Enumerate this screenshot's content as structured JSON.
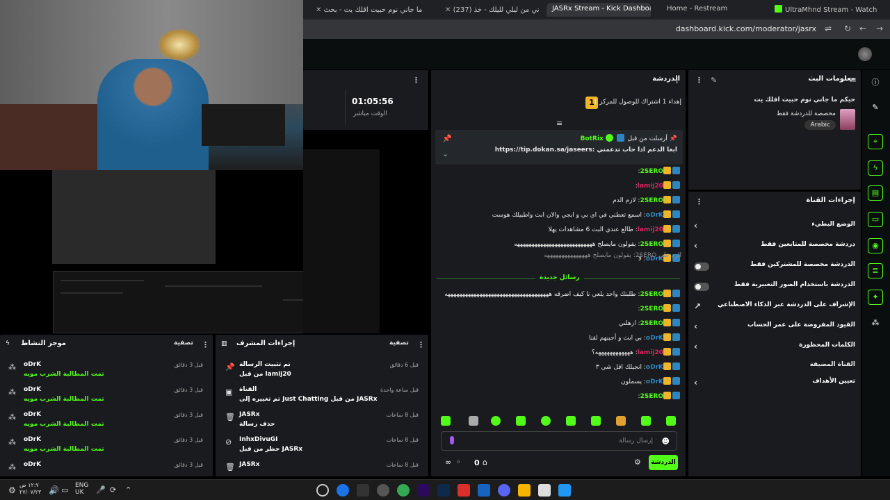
{
  "browser": {
    "tabs": [
      {
        "label": "ما جاني نوم حبيت اقلك يت - بحث",
        "active": false
      },
      {
        "label": "(237) خذني من ليلي لليلك - خذ...",
        "active": false
      },
      {
        "label": "JASRx Stream - Kick Dashboard",
        "active": true
      },
      {
        "label": "Home - Restream",
        "active": false
      },
      {
        "label": "UltraMhnd Stream - Watch",
        "active": false
      }
    ],
    "url": "dashboard.kick.com/moderator/jasrx"
  },
  "stream_panel": {
    "timer": "01:05:56",
    "timer_label": "الوقت مباشر"
  },
  "chat": {
    "title": "الدردشة",
    "goal_badge": "1",
    "goal_text": "إهداء 1 اشتراك للوصول للمركز 1",
    "pinned": {
      "label": "أرسلت من قبل",
      "user": "BotRix",
      "text": "ابغا الدعم اذا حاب تدعمني :https://tip.dokan.sa/jaseers"
    },
    "messages": [
      {
        "user": "2SERO",
        "text": "",
        "color": "#53fc18"
      },
      {
        "user": "lamij20",
        "text": "",
        "color": "#e0245e"
      },
      {
        "user": "2SERO",
        "text": "لازم الدم",
        "color": "#53fc18"
      },
      {
        "user": "oDrK",
        "text": "اسمع تعطني في اي بي و ايجي والان ابث واطبيلك هوست",
        "color": "#2e86c1"
      },
      {
        "user": "lamij20",
        "text": "طالع عندي البث 6 مشاهدات يهلا",
        "color": "#e0245e"
      },
      {
        "user": "2SERO",
        "text": "يقولون مايصلح هههههههههههههههههههههههههههه",
        "color": "#53fc18"
      },
      {
        "user": "oDrK",
        "text": "لا",
        "color": "#2e86c1"
      }
    ],
    "reply_to": "الرد على 2SERO: يقولون مايصلح هههههههههههههههه",
    "new_messages": "رسائل جديدة",
    "messages_after": [
      {
        "user": "2SERO",
        "text": "طلبتك واحد يلعي نا كيف اضرقه ههههههههههههههههههههههههههههههههههههه",
        "color": "#53fc18"
      },
      {
        "user": "2SERO",
        "text": "",
        "color": "#53fc18"
      },
      {
        "user": "2SERO",
        "text": "ازهلني",
        "color": "#53fc18"
      },
      {
        "user": "oDrK",
        "text": "بي ابث و أجيبهم لقنا",
        "color": "#2e86c1"
      },
      {
        "user": "lamij20",
        "text": "ههههههههههههه؟",
        "color": "#e0245e"
      },
      {
        "user": "oDrK",
        "text": "انجيلك اقل شي ٣",
        "color": "#2e86c1"
      },
      {
        "user": "oDrK",
        "text": "يسملون",
        "color": "#2e86c1"
      },
      {
        "user": "2SERO",
        "text": "",
        "color": "#53fc18"
      }
    ],
    "input_placeholder": "إرسال رسالة",
    "user_count": "0",
    "send_button": "الدردشة"
  },
  "stream_info": {
    "title": "معلومات البث",
    "stream_title": "حيكم ما جاني نوم حبيت اقلك يت",
    "category": "مخصصة للدردشة فقط",
    "language": "Arabic"
  },
  "channel_actions": {
    "title": "إجراءات القناة",
    "rows": [
      {
        "label": "الوضع البطيء",
        "type": "chevron"
      },
      {
        "label": "دردشة مخصصة للمتابعين فقط",
        "type": "chevron"
      },
      {
        "label": "الدردشة مخصصة للمشتركين فقط",
        "type": "toggle"
      },
      {
        "label": "الدردشة باستخدام الصور التعبيرية فقط",
        "type": "toggle"
      },
      {
        "label": "الإشراف على الدردشة عبر الذكاء الاصطناعي",
        "type": "external"
      },
      {
        "label": "القيود المفروضة على عمر الحساب",
        "type": "chevron"
      },
      {
        "label": "الكلمات المحظورة",
        "type": "chevron"
      }
    ],
    "section": "القناة المضيفة",
    "host_row": "تعيين الأهداف"
  },
  "activity": {
    "title": "موجز النشاط",
    "filter": "تصفية",
    "entries": [
      {
        "name": "oDrK",
        "sub": "تمت المطالبة الشرب مويه",
        "time": "قبل 3 دقائق"
      },
      {
        "name": "oDrK",
        "sub": "تمت المطالبة الشرب مويه",
        "time": "قبل 3 دقائق"
      },
      {
        "name": "oDrK",
        "sub": "تمت المطالبة الشرب مويه",
        "time": "قبل 3 دقائق"
      },
      {
        "name": "oDrK",
        "sub": "تمت المطالبة الشرب مويه",
        "time": "قبل 3 دقائق"
      },
      {
        "name": "oDrK",
        "sub": "",
        "time": "قبل 3 دقائق"
      }
    ]
  },
  "mod_actions": {
    "title": "إجراءات المشرف",
    "filter": "تصفية",
    "entries": [
      {
        "name": "تم تثبيت الرسالة",
        "sub": "من قبل lamij20",
        "time": "قبل 6 دقائق"
      },
      {
        "name": "القناة",
        "sub": "تم تغييره إلى Just Chatting من قبل JASRx",
        "time": "قبل ساعة واحدة"
      },
      {
        "name": "JASRx",
        "sub": "حذف رسالة",
        "time": "قبل 8 ساعات"
      },
      {
        "name": "InhxDivuGI",
        "sub": "حظر من قبل JASRx",
        "time": "قبل 8 ساعات"
      },
      {
        "name": "JASRx",
        "sub": "",
        "time": "قبل 8 ساعات"
      }
    ]
  },
  "taskbar": {
    "time": "١٢:٧ ص",
    "date": "٢٧/٠٧/٢٣",
    "lang": "ENG",
    "region": "UK"
  }
}
